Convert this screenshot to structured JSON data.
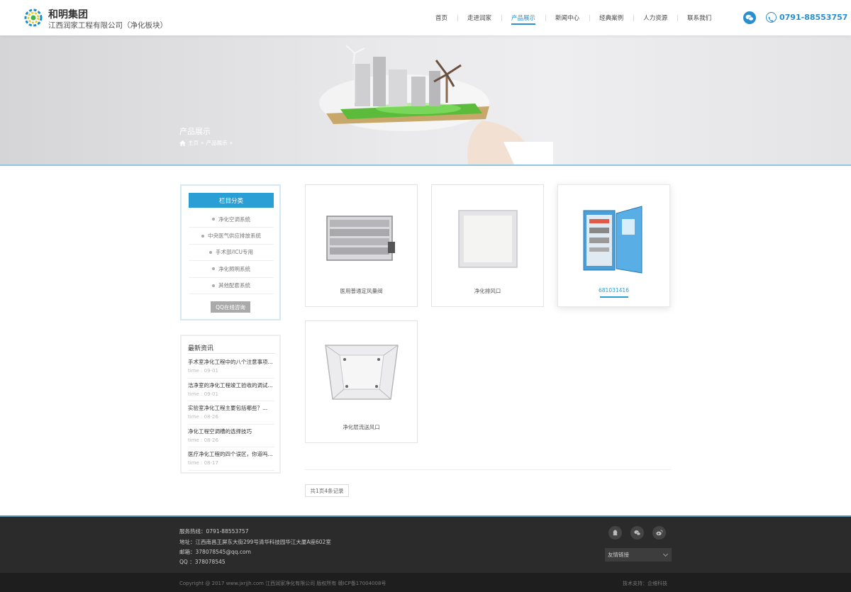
{
  "header": {
    "brand": "和明集团",
    "company": "江西润家工程有限公司（净化板块）",
    "phone": "0791-88553757",
    "nav": [
      "首页",
      "走进润家",
      "产品展示",
      "新闻中心",
      "经典案例",
      "人力资源",
      "联系我们"
    ],
    "active_nav": "产品展示"
  },
  "banner": {
    "title": "产品展示",
    "breadcrumb": [
      "主页",
      "»",
      "产品展示",
      "»"
    ]
  },
  "sidebar": {
    "category_title": "栏目分类",
    "categories": [
      "净化空调系统",
      "中央医气供应排放系统",
      "手术部/ICU专用",
      "净化照明系统",
      "其他配套系统"
    ],
    "qq_button": "QQ在线咨询",
    "news_title": "最新资讯",
    "news": [
      {
        "title": "手术室净化工程中的八个注意事项...",
        "time": "time : 09-01"
      },
      {
        "title": "洁净室的净化工程竣工验收的调试...",
        "time": "time : 09-01"
      },
      {
        "title": "实验室净化工程主要包括哪些？...",
        "time": "time : 08-26"
      },
      {
        "title": "净化工程空调槽的选择技巧",
        "time": "time : 08-26"
      },
      {
        "title": "医疗净化工程的四个误区，你道吗...",
        "time": "time : 08-17"
      }
    ]
  },
  "products": [
    {
      "name": "医用普通定风量阀"
    },
    {
      "name": "净化排风口"
    },
    {
      "name": "681031416"
    },
    {
      "name": "净化层流送风口"
    }
  ],
  "pager": "共1页4条记录",
  "footer": {
    "hotline": "服务热线：0791-88553757",
    "address": "地址：江西南昌王屏东大街299号清华科技园华江大厦A座602室",
    "email": "邮箱：378078545@qq.com",
    "qq": "QQ  ：378078545",
    "links_label": "友情链接",
    "copyright": "Copyright @ 2017 www.jxrjjh.com 江西润家净化有限公司 版权所有 赣ICP备17004008号",
    "tech_support": "技术支持：企维科技"
  },
  "colors": {
    "accent": "#2a9fd6",
    "footer": "#2b2b2b"
  }
}
